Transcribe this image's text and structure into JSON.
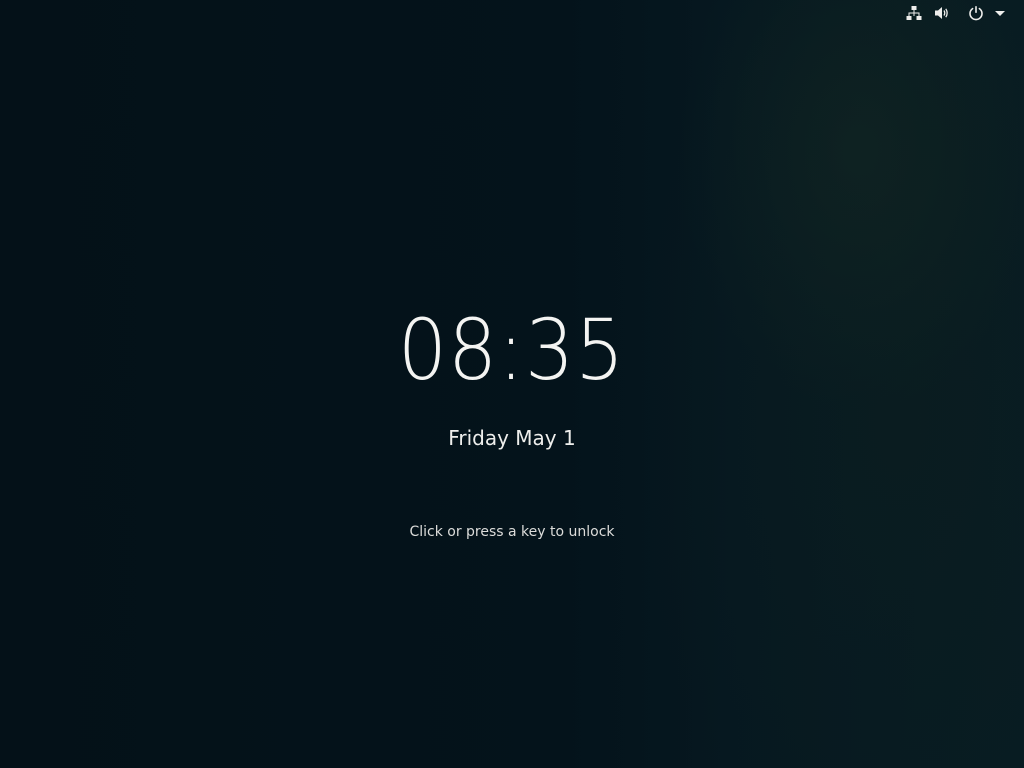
{
  "lock_screen": {
    "time": "08:35",
    "date": "Friday May 1",
    "hint": "Click or press a key to unlock"
  },
  "top_bar": {
    "indicators": [
      {
        "icon": "network-wired-icon"
      },
      {
        "icon": "volume-icon"
      },
      {
        "icon": "power-icon"
      },
      {
        "icon": "dropdown-arrow-icon"
      }
    ]
  },
  "colors": {
    "background": "#04121a",
    "text": "#eeeeec"
  }
}
